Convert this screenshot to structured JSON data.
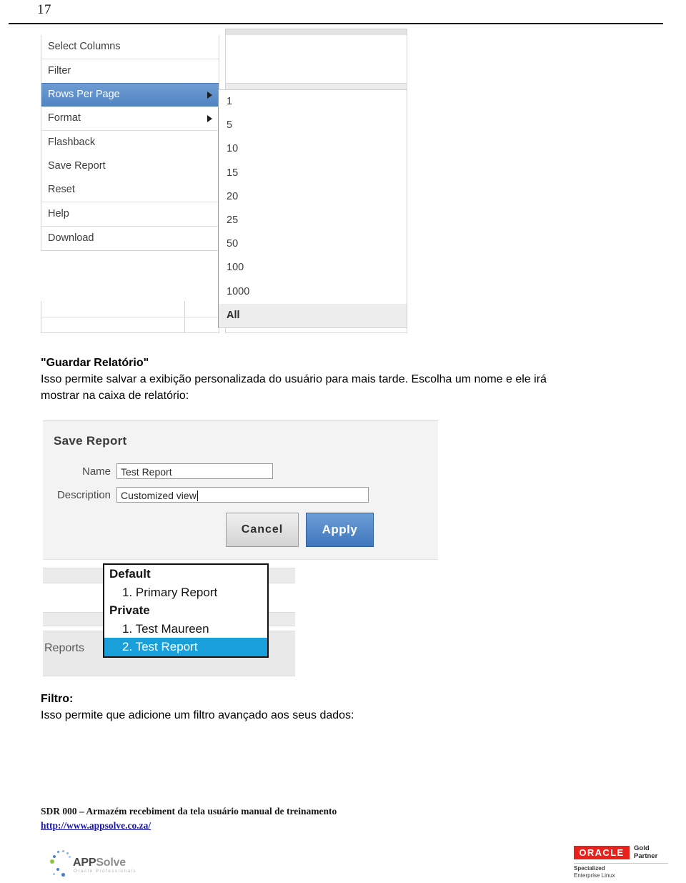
{
  "page": {
    "number": "17"
  },
  "screenshot_actions_menu": {
    "items": [
      {
        "label": "Select Columns",
        "has_submenu": false,
        "selected": false
      },
      {
        "label": "Filter",
        "has_submenu": false,
        "selected": false
      },
      {
        "label": "Rows Per Page",
        "has_submenu": true,
        "selected": true
      },
      {
        "label": "Format",
        "has_submenu": true,
        "selected": false
      },
      {
        "label": "Flashback",
        "has_submenu": false,
        "selected": false
      },
      {
        "label": "Save Report",
        "has_submenu": false,
        "selected": false
      },
      {
        "label": "Reset",
        "has_submenu": false,
        "selected": false
      },
      {
        "label": "Help",
        "has_submenu": false,
        "selected": false
      },
      {
        "label": "Download",
        "has_submenu": false,
        "selected": false
      }
    ],
    "rows_per_page_submenu": {
      "options": [
        "1",
        "5",
        "10",
        "15",
        "20",
        "25",
        "50",
        "100",
        "1000",
        "All"
      ]
    },
    "colors": {
      "selected_row": "#5d91cc",
      "submenu_last_bg": "#ededed"
    }
  },
  "copy_save_report": {
    "heading": "\"Guardar Relatório\"",
    "line1": "Isso permite  salvar a exibição personalizada do usuário para mais tarde. Escolha um nome e ele irá",
    "line2": "mostrar na caixa de relatório:"
  },
  "screenshot_save_report": {
    "title": "Save Report",
    "fields": [
      {
        "label": "Name",
        "value": "Test Report"
      },
      {
        "label": "Description",
        "value": "Customized view"
      }
    ],
    "buttons": {
      "cancel": "Cancel",
      "apply": "Apply"
    },
    "colors": {
      "apply_button": "#4a80c0",
      "panel_bg": "#f3f3f3"
    }
  },
  "screenshot_reports_dropdown": {
    "label": "Reports",
    "options": [
      {
        "text": "Default",
        "type": "group",
        "selected": false
      },
      {
        "text": "1. Primary Report",
        "type": "child",
        "selected": false
      },
      {
        "text": "Private",
        "type": "group",
        "selected": false
      },
      {
        "text": "1. Test Maureen",
        "type": "child",
        "selected": false
      },
      {
        "text": "2. Test Report",
        "type": "child",
        "selected": true
      }
    ],
    "colors": {
      "selected_option": "#19a0db"
    }
  },
  "copy_filter": {
    "heading": "Filtro:",
    "line1": "Isso permite que adicione um filtro avançado aos seus dados:"
  },
  "footer": {
    "line1": "SDR 000 – Armazém recebiment da tela usuário manual de treinamento",
    "link": "http://www.appsolve.co.za/"
  },
  "logos": {
    "appsolve": {
      "name_bold": "APP",
      "name_light": "Solve",
      "tagline": "Oracle Professionals"
    },
    "oracle": {
      "brand": "ORACLE",
      "partner_line1": "Gold",
      "partner_line2": "Partner",
      "spec_line1": "Specialized",
      "spec_line2": "Enterprise Linux",
      "brand_color": "#e8211a"
    }
  }
}
